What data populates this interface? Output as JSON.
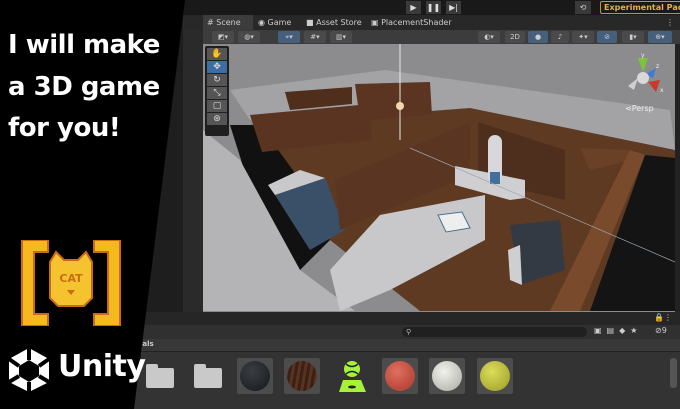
{
  "headline": {
    "line1": "I will make",
    "line2": "a 3D game",
    "line3": "for you!"
  },
  "logo": {
    "text": "CAT",
    "color": "#f5b81f"
  },
  "brand": {
    "name": "Unity"
  },
  "editor": {
    "play_controls": [
      "play",
      "pause",
      "step"
    ],
    "experimental_label": "Experimental Packag",
    "tabs": [
      {
        "label": "Scene",
        "icon": "grid-icon",
        "active": true
      },
      {
        "label": "Game",
        "icon": "gamepad-icon"
      },
      {
        "label": "Asset Store",
        "icon": "bag-icon"
      },
      {
        "label": "PlacementShader",
        "icon": "shader-icon"
      }
    ],
    "toolbar": {
      "mode_2d": "2D"
    },
    "tools": [
      "hand",
      "move",
      "rotate",
      "scale",
      "rect",
      "transform"
    ],
    "active_tool": "move",
    "gizmo": {
      "y": "y",
      "z": "z",
      "x": "x",
      "projection": "Persp"
    },
    "project": {
      "breadcrumb": "ials",
      "search_placeholder": "",
      "hidden_count": "9",
      "assets": [
        {
          "type": "folder"
        },
        {
          "type": "folder"
        },
        {
          "type": "material",
          "color": "#1e2226"
        },
        {
          "type": "material",
          "color": "#4a2a1c"
        },
        {
          "type": "physics-material",
          "color": "#a6f13a"
        },
        {
          "type": "material",
          "color": "#c9453a"
        },
        {
          "type": "material",
          "color": "#d8d8d0"
        },
        {
          "type": "material",
          "color": "#c3c43a"
        }
      ]
    }
  },
  "colors": {
    "active_tab": "#3c3c3c",
    "accent": "#46607c",
    "warning": "#e3b341"
  }
}
